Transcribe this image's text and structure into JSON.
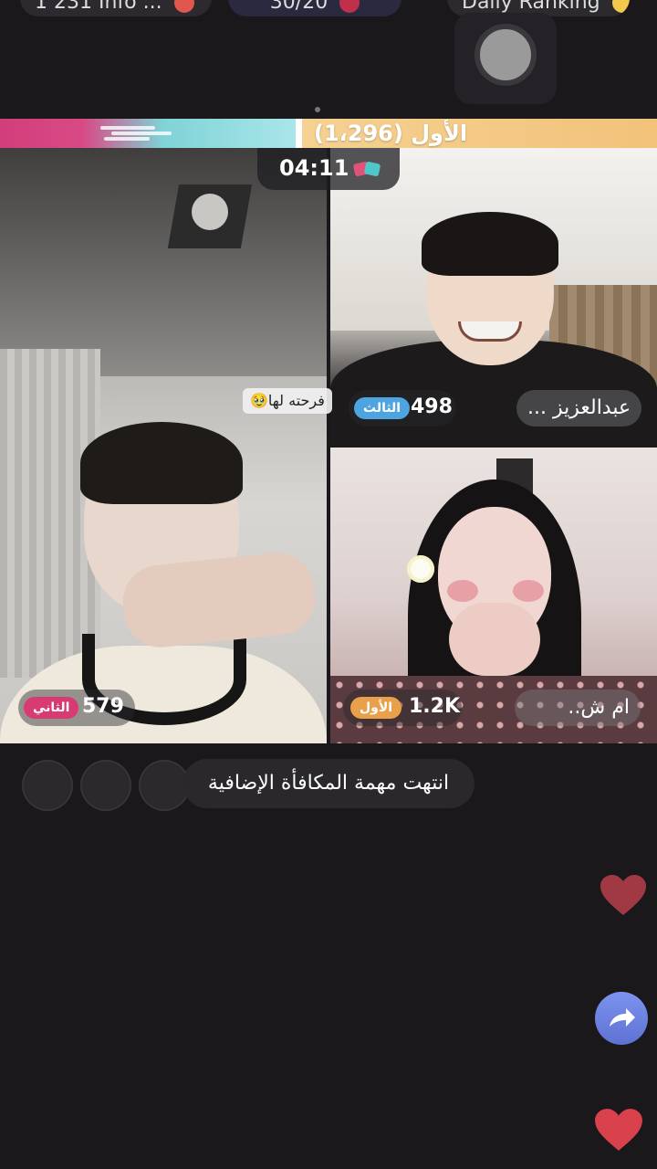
{
  "top": {
    "left_pill_text": "1 231 Info ...",
    "mid_pill_text": "30/20",
    "right_pill_text": "Daily Ranking"
  },
  "pk": {
    "leader_label": "الأول (1،296)",
    "left_share": 0.45
  },
  "timer": "04:11",
  "participants": [
    {
      "position": "left",
      "score": "579",
      "rank": "الثاني",
      "rank_color": "#d83a72"
    },
    {
      "position": "top-right",
      "score": "498",
      "rank": "الثالث",
      "rank_color": "#4ea4e0",
      "name": "عبدالعزيز ..."
    },
    {
      "position": "bottom-right",
      "score": "1.2K",
      "rank": "الأول",
      "rank_color": "#e9a04b",
      "name": "ام ش.."
    }
  ],
  "comment": "فرحته لها🥹",
  "notice": "انتهت مهمة المكافأة الإضافية",
  "colors": {
    "background": "#1a181b",
    "heart": "#d9414c",
    "share": "#6b80e0"
  },
  "icons": [
    "record-icon",
    "pk-icon",
    "heart-icon",
    "share-icon",
    "flower-icon"
  ]
}
